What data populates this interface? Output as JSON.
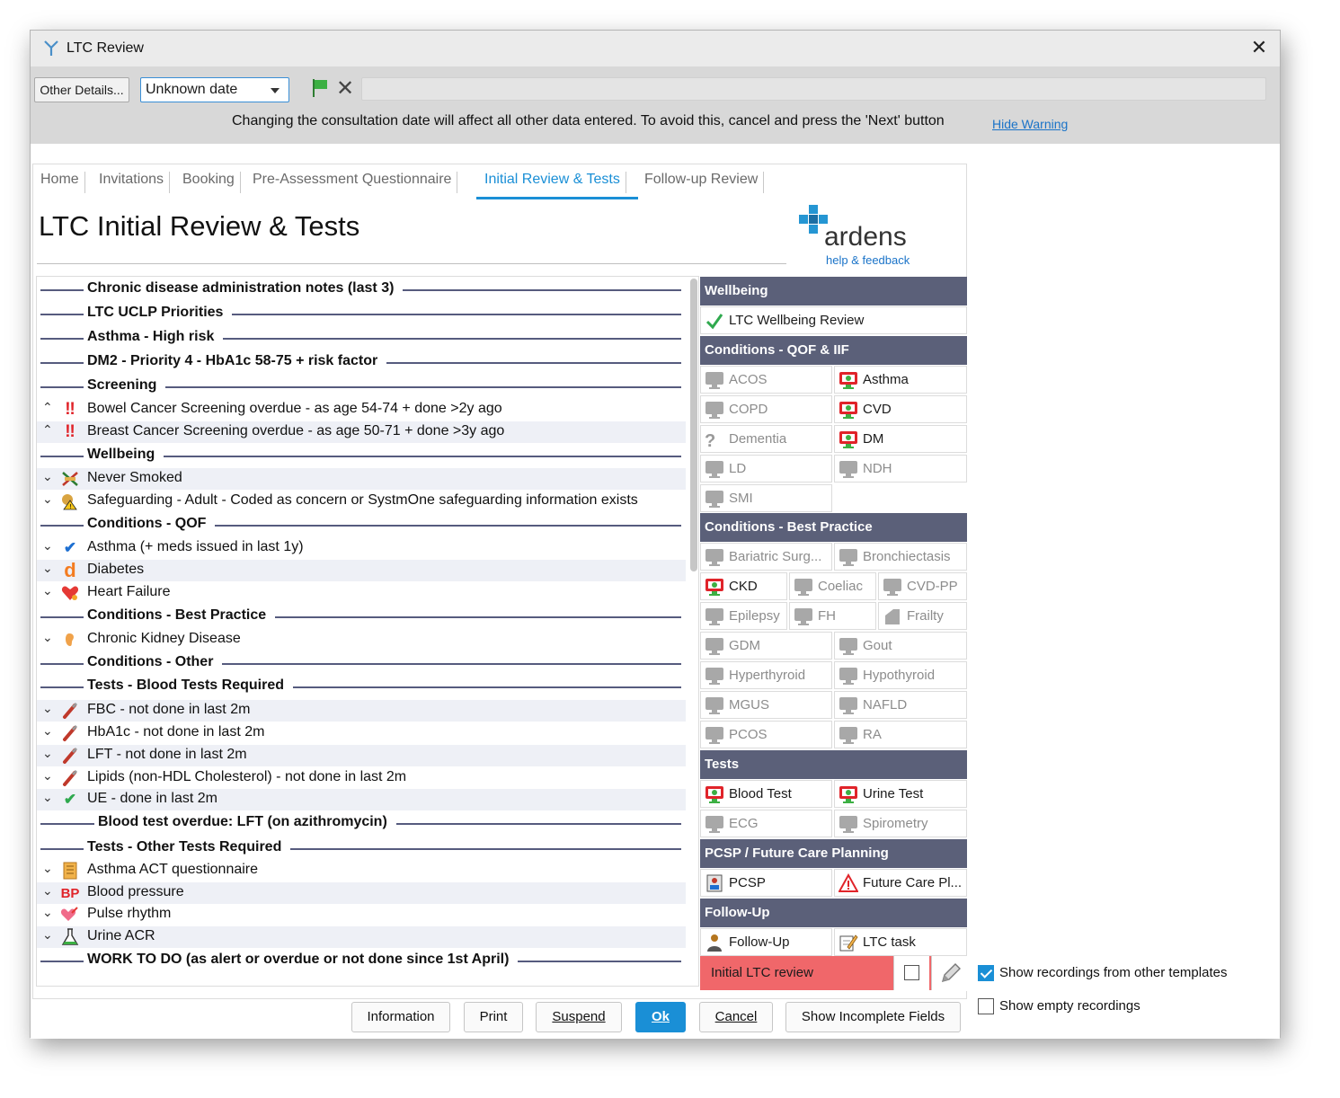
{
  "window": {
    "title": "LTC Review"
  },
  "toolbar": {
    "other_details": "Other Details...",
    "date_value": "Unknown date",
    "warning": "Changing the consultation date will affect all other data entered. To avoid this, cancel and press the 'Next' button",
    "hide_warning": "Hide Warning"
  },
  "tabs": [
    "Home",
    "Invitations",
    "Booking",
    "Pre-Assessment Questionnaire",
    "Initial Review & Tests",
    "Follow-up Review"
  ],
  "active_tab": "Initial Review & Tests",
  "page_title": "LTC Initial Review & Tests",
  "logo": {
    "text": "ardens",
    "sub": "help & feedback"
  },
  "rows": [
    {
      "type": "header",
      "text": "Chronic disease administration notes (last 3)"
    },
    {
      "type": "header",
      "text": "LTC UCLP Priorities"
    },
    {
      "type": "header",
      "text": "Asthma - High risk"
    },
    {
      "type": "header",
      "text": "DM2 - Priority 4 - HbA1c 58-75 + risk factor"
    },
    {
      "type": "header",
      "text": "Screening"
    },
    {
      "type": "item",
      "chev": "^",
      "icon": "double-exclamation-icon",
      "text": "Bowel Cancer Screening overdue - as age 54-74 + done >2y ago"
    },
    {
      "type": "item",
      "chev": "^",
      "icon": "double-exclamation-icon",
      "text": "Breast Cancer Screening overdue - as age 50-71 + done >3y ago"
    },
    {
      "type": "header",
      "text": "Wellbeing"
    },
    {
      "type": "item",
      "chev": "v",
      "icon": "no-smoking-icon",
      "text": "Never Smoked"
    },
    {
      "type": "item",
      "chev": "v",
      "icon": "safeguarding-warning-icon",
      "text": "Safeguarding - Adult - Coded as concern or SystmOne safeguarding information exists"
    },
    {
      "type": "header",
      "text": "Conditions - QOF"
    },
    {
      "type": "item",
      "chev": "v",
      "icon": "blue-check-icon",
      "text": "Asthma (+ meds issued in last 1y)"
    },
    {
      "type": "item",
      "chev": "v",
      "icon": "diabetes-d-icon",
      "text": "Diabetes"
    },
    {
      "type": "item",
      "chev": "v",
      "icon": "heart-failure-icon",
      "text": "Heart Failure"
    },
    {
      "type": "header",
      "text": "Conditions - Best Practice"
    },
    {
      "type": "item",
      "chev": "v",
      "icon": "kidney-icon",
      "text": "Chronic Kidney Disease"
    },
    {
      "type": "header",
      "text": "Conditions - Other"
    },
    {
      "type": "header",
      "text": "Tests - Blood Tests Required"
    },
    {
      "type": "item",
      "chev": "v",
      "icon": "blood-tube-icon",
      "text": "FBC - not done in last 2m"
    },
    {
      "type": "item",
      "chev": "v",
      "icon": "blood-tube-icon",
      "text": "HbA1c - not done in last 2m"
    },
    {
      "type": "item",
      "chev": "v",
      "icon": "blood-tube-icon",
      "text": "LFT - not done in last 2m"
    },
    {
      "type": "item",
      "chev": "v",
      "icon": "blood-tube-icon",
      "text": "Lipids (non-HDL Cholesterol) - not done in last 2m"
    },
    {
      "type": "item",
      "chev": "v",
      "icon": "green-check-icon",
      "text": "UE - done in last 2m"
    },
    {
      "type": "header",
      "text": "Blood test overdue: LFT (on azithromycin)"
    },
    {
      "type": "header",
      "text": "Tests - Other Tests Required"
    },
    {
      "type": "item",
      "chev": "v",
      "icon": "questionnaire-icon",
      "text": "Asthma ACT questionnaire"
    },
    {
      "type": "item",
      "chev": "v",
      "icon": "bp-icon",
      "text": "Blood pressure"
    },
    {
      "type": "item",
      "chev": "v",
      "icon": "pulse-heart-icon",
      "text": "Pulse rhythm"
    },
    {
      "type": "item",
      "chev": "v",
      "icon": "flask-icon",
      "text": "Urine ACR"
    },
    {
      "type": "header",
      "text": "WORK TO DO (as alert or overdue or not done since 1st April)"
    }
  ],
  "right": {
    "sections": [
      {
        "title": "Wellbeing"
      },
      {
        "title": "Conditions - QOF & IIF"
      },
      {
        "title": "Conditions - Best Practice"
      },
      {
        "title": "Tests"
      },
      {
        "title": "PCSP / Future Care Planning"
      },
      {
        "title": "Follow-Up"
      }
    ],
    "cells": [
      {
        "label": "LTC Wellbeing Review",
        "icon": "green-check-icon",
        "active": true
      },
      {
        "label": "ACOS",
        "icon": "monitor-grey-icon",
        "active": false
      },
      {
        "label": "Asthma",
        "icon": "monitor-red-icon",
        "active": true
      },
      {
        "label": "COPD",
        "icon": "monitor-grey-icon",
        "active": false
      },
      {
        "label": "CVD",
        "icon": "monitor-red-icon",
        "active": true
      },
      {
        "label": "Dementia",
        "icon": "question-mark-icon",
        "active": false
      },
      {
        "label": "DM",
        "icon": "monitor-red-icon",
        "active": true
      },
      {
        "label": "LD",
        "icon": "monitor-grey-icon",
        "active": false
      },
      {
        "label": "NDH",
        "icon": "monitor-grey-icon",
        "active": false
      },
      {
        "label": "SMI",
        "icon": "monitor-grey-icon",
        "active": false
      },
      {
        "label": "Bariatric Surg...",
        "icon": "monitor-grey-icon",
        "active": false
      },
      {
        "label": "Bronchiectasis",
        "icon": "monitor-grey-icon",
        "active": false
      },
      {
        "label": "CKD",
        "icon": "monitor-red-icon",
        "active": true
      },
      {
        "label": "Coeliac",
        "icon": "monitor-grey-icon",
        "active": false
      },
      {
        "label": "CVD-PP",
        "icon": "monitor-grey-icon",
        "active": false
      },
      {
        "label": "Epilepsy",
        "icon": "monitor-grey-icon",
        "active": false
      },
      {
        "label": "FH",
        "icon": "monitor-grey-icon",
        "active": false
      },
      {
        "label": "Frailty",
        "icon": "frailty-icon",
        "active": false
      },
      {
        "label": "GDM",
        "icon": "monitor-grey-icon",
        "active": false
      },
      {
        "label": "Gout",
        "icon": "monitor-grey-icon",
        "active": false
      },
      {
        "label": "Hyperthyroid",
        "icon": "monitor-grey-icon",
        "active": false
      },
      {
        "label": "Hypothyroid",
        "icon": "monitor-grey-icon",
        "active": false
      },
      {
        "label": "MGUS",
        "icon": "monitor-grey-icon",
        "active": false
      },
      {
        "label": "NAFLD",
        "icon": "monitor-grey-icon",
        "active": false
      },
      {
        "label": "PCOS",
        "icon": "monitor-grey-icon",
        "active": false
      },
      {
        "label": "RA",
        "icon": "monitor-grey-icon",
        "active": false
      },
      {
        "label": "Blood Test",
        "icon": "monitor-red-icon",
        "active": true
      },
      {
        "label": "Urine Test",
        "icon": "monitor-red-icon",
        "active": true
      },
      {
        "label": "ECG",
        "icon": "monitor-grey-icon",
        "active": false
      },
      {
        "label": "Spirometry",
        "icon": "monitor-grey-icon",
        "active": false
      },
      {
        "label": "PCSP",
        "icon": "person-card-icon",
        "active": true
      },
      {
        "label": "Future Care Pl...",
        "icon": "warning-triangle-icon",
        "active": true
      },
      {
        "label": "Follow-Up",
        "icon": "person-icon",
        "active": true
      },
      {
        "label": "LTC task",
        "icon": "task-pencil-icon",
        "active": true
      }
    ],
    "red_row": "Initial LTC review"
  },
  "options": {
    "show_other": "Show recordings from other templates",
    "show_other_checked": true,
    "show_empty": "Show empty recordings",
    "show_empty_checked": false
  },
  "buttons": [
    "Information",
    "Print",
    "Suspend",
    "Ok",
    "Cancel",
    "Show Incomplete Fields"
  ],
  "colors": {
    "accent": "#1a8fd6",
    "section_bg": "#5b6079",
    "alert_red": "#f0676a",
    "rule": "#565b7e"
  }
}
